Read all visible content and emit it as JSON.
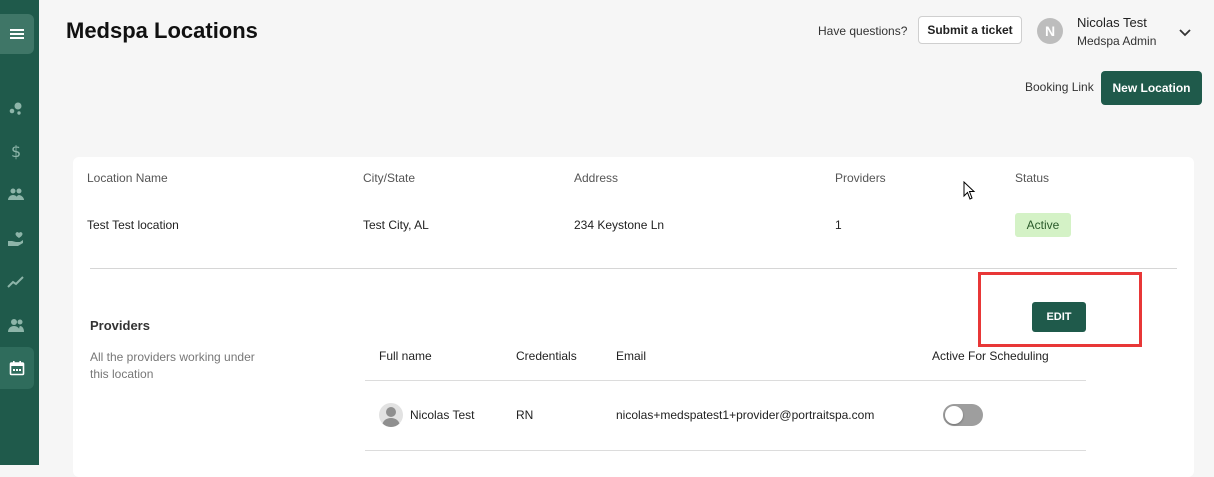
{
  "sidebar": {
    "items": [
      {
        "icon": "menu-icon",
        "active": false
      },
      {
        "icon": "dots-icon",
        "active": false
      },
      {
        "icon": "dollar-icon",
        "active": false
      },
      {
        "icon": "patients-icon",
        "active": false
      },
      {
        "icon": "hand-heart-icon",
        "active": false
      },
      {
        "icon": "chart-line-icon",
        "active": false
      },
      {
        "icon": "users-icon",
        "active": false
      },
      {
        "icon": "calendar-icon",
        "active": true
      }
    ]
  },
  "header": {
    "title": "Medspa Locations",
    "questions_label": "Have questions?",
    "ticket_label": "Submit a ticket",
    "user": {
      "initial": "N",
      "name": "Nicolas Test",
      "role": "Medspa Admin"
    },
    "booking_link_label": "Booking Link",
    "new_location_label": "New Location"
  },
  "locations_table": {
    "columns": [
      "Location Name",
      "City/State",
      "Address",
      "Providers",
      "Status"
    ],
    "rows": [
      {
        "name": "Test Test location",
        "city_state": "Test City, AL",
        "address": "234 Keystone Ln",
        "providers": "1",
        "status": "Active"
      }
    ]
  },
  "providers_section": {
    "title": "Providers",
    "description": "All the providers working under this location",
    "edit_label": "EDIT",
    "columns": [
      "Full name",
      "Credentials",
      "Email",
      "Active For Scheduling"
    ],
    "rows": [
      {
        "name": "Nicolas Test",
        "credentials": "RN",
        "email": "nicolas+medspatest1+provider@portraitspa.com",
        "active_for_scheduling": false
      }
    ]
  },
  "colors": {
    "sidebar": "#1f5a4b",
    "primary_button": "#1f5a4b",
    "status_active_bg": "#d4f2c6",
    "highlight": "#e83737"
  }
}
